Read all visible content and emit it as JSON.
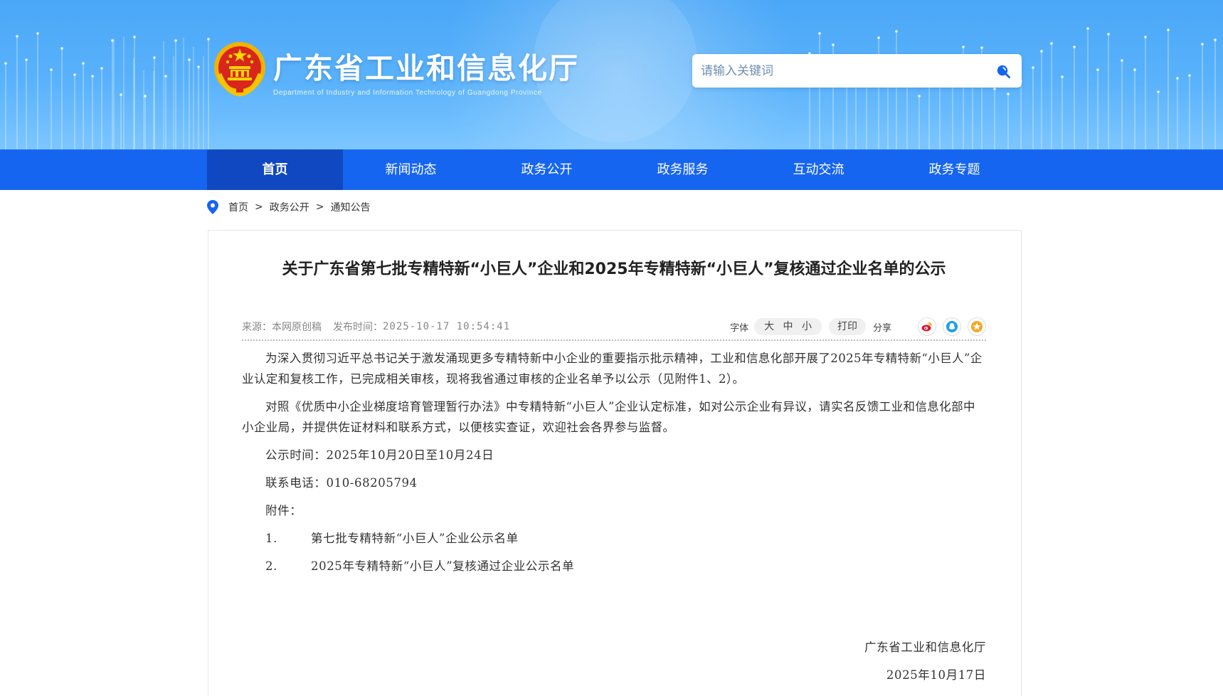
{
  "header": {
    "site_title": "广东省工业和信息化厅",
    "site_subtitle": "Department of Industry and Information Technology of Guangdong Province",
    "emblem_icon": "national-emblem-icon",
    "search": {
      "placeholder": "请输入关键词",
      "value": "",
      "icon": "search-icon"
    }
  },
  "nav": {
    "items": [
      {
        "label": "首页",
        "active": true
      },
      {
        "label": "新闻动态"
      },
      {
        "label": "政务公开"
      },
      {
        "label": "政务服务"
      },
      {
        "label": "互动交流"
      },
      {
        "label": "政务专题"
      }
    ]
  },
  "breadcrumb": {
    "icon": "location-pin-icon",
    "items": [
      "首页",
      "政务公开",
      "通知公告"
    ],
    "separator": ">"
  },
  "article": {
    "title": "关于广东省第七批专精特新“小巨人”企业和2025年专精特新“小巨人”复核通过企业名单的公示",
    "meta": {
      "source_label": "来源：",
      "source": "本网原创稿",
      "date_label": "发布时间：",
      "date": "2025-10-17 10:54:41",
      "font_label": "字体",
      "font_sizes": [
        "大",
        "中",
        "小"
      ],
      "print_label": "打印",
      "share_label": "分享",
      "share_icons": [
        "weibo-icon",
        "qq-icon",
        "favorite-star-icon"
      ]
    },
    "paragraphs": [
      "为深入贯彻习近平总书记关于激发涌现更多专精特新中小企业的重要指示批示精神，工业和信息化部开展了2025年专精特新“小巨人”企业认定和复核工作，已完成相关审核，现将我省通过审核的企业名单予以公示（见附件1、2）。",
      "对照《优质中小企业梯度培育管理暂行办法》中专精特新“小巨人”企业认定标准，如对公示企业有异议，请实名反馈工业和信息化部中小企业局，并提供佐证材料和联系方式，以便核实查证，欢迎社会各界参与监督。"
    ],
    "notice_period": "公示时间：2025年10月20日至10月24日",
    "contact_phone": "联系电话：010-68205794",
    "attachments_label": "附件：",
    "attachments": [
      {
        "num": "1.",
        "title": "第七批专精特新“小巨人”企业公示名单"
      },
      {
        "num": "2.",
        "title": "2025年专精特新“小巨人”复核通过企业公示名单"
      }
    ],
    "signature": {
      "org": "广东省工业和信息化厅",
      "date": "2025年10月17日"
    }
  },
  "colors": {
    "nav_bg": "#1665f0",
    "nav_active_bg": "#1048c2",
    "banner_top": "#4aa7f7",
    "weibo": "#e6162d",
    "qq": "#1ba1e2",
    "star": "#f5a623"
  }
}
